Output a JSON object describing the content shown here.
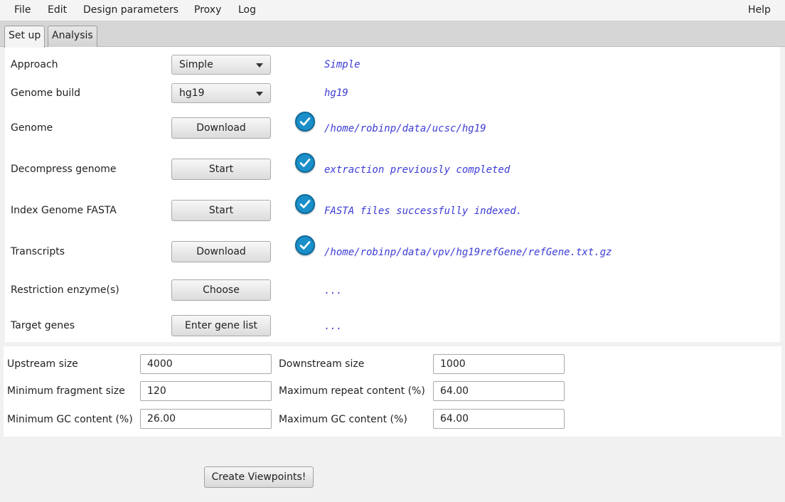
{
  "menubar": {
    "file": "File",
    "edit": "Edit",
    "design_parameters": "Design parameters",
    "proxy": "Proxy",
    "log": "Log",
    "help": "Help"
  },
  "tabs": {
    "setup": "Set up",
    "analysis": "Analysis"
  },
  "rows": {
    "approach": {
      "label": "Approach",
      "value": "Simple",
      "status": "Simple"
    },
    "genome_build": {
      "label": "Genome build",
      "value": "hg19",
      "status": "hg19"
    },
    "genome": {
      "label": "Genome",
      "button": "Download",
      "status": "/home/robinp/data/ucsc/hg19"
    },
    "decompress": {
      "label": "Decompress genome",
      "button": "Start",
      "status": "extraction previously completed"
    },
    "index": {
      "label": "Index Genome FASTA",
      "button": "Start",
      "status": "FASTA files successfully indexed."
    },
    "transcripts": {
      "label": "Transcripts",
      "button": "Download",
      "status": "/home/robinp/data/vpv/hg19refGene/refGene.txt.gz"
    },
    "enzymes": {
      "label": "Restriction enzyme(s)",
      "button": "Choose",
      "status": "..."
    },
    "targets": {
      "label": "Target genes",
      "button": "Enter gene list",
      "status": "..."
    }
  },
  "params": {
    "upstream": {
      "label": "Upstream size",
      "value": "4000"
    },
    "downstream": {
      "label": "Downstream size",
      "value": "1000"
    },
    "min_fragment": {
      "label": "Minimum fragment size",
      "value": "120"
    },
    "max_repeat": {
      "label": "Maximum repeat content (%)",
      "value": "64.00"
    },
    "min_gc": {
      "label": "Minimum GC content (%)",
      "value": "26.00"
    },
    "max_gc": {
      "label": "Maximum GC content (%)",
      "value": "64.00"
    }
  },
  "actions": {
    "create": "Create Viewpoints!"
  },
  "colors": {
    "status_text": "#3c3cd6",
    "check_badge": "#1a8fc9"
  },
  "icons": {
    "check": "check-circle-icon",
    "dropdown": "chevron-down-icon"
  }
}
